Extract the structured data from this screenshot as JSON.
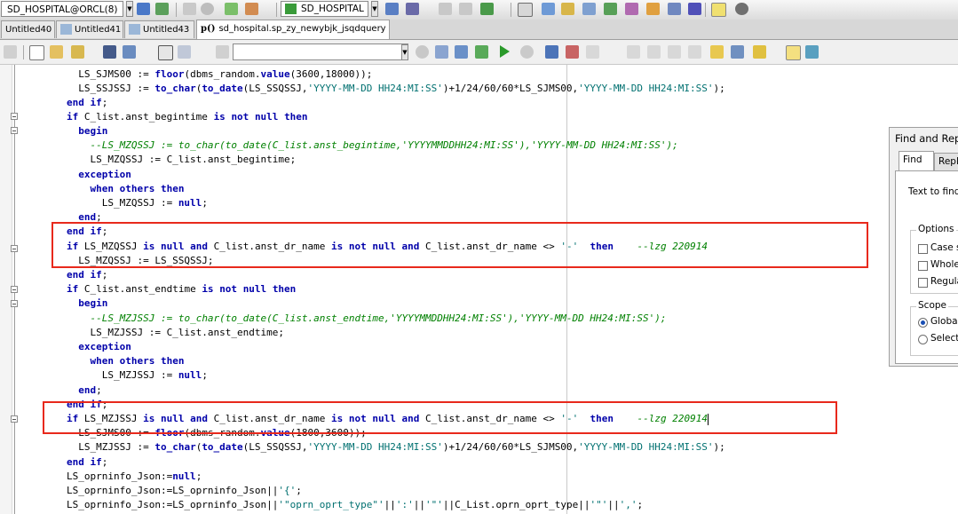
{
  "toolbar": {
    "connection": "SD_HOSPITAL@ORCL(8)",
    "database": "SD_HOSPITAL"
  },
  "tabs": [
    {
      "label": "Untitled40"
    },
    {
      "label": "Untitled41"
    },
    {
      "label": "Untitled43"
    },
    {
      "label": "sd_hospital.sp_zy_newybjk_jsqdquery",
      "prefix": "p()"
    }
  ],
  "find_dialog": {
    "title": "Find and Rep",
    "tab_find": "Find",
    "tab_replace": "Repl",
    "text_to_find_label": "Text to find:",
    "options_label": "Options",
    "options": [
      "Case se",
      "Whole w",
      "Regular"
    ],
    "scope_label": "Scope",
    "scope_options": [
      "Global",
      "Selecte"
    ],
    "scope_selected": "Global"
  },
  "code_lines": [
    "          LS_SJMS00 := floor(dbms_random.value(3600,18000));",
    "          LS_SSJSSJ := to_char(to_date(LS_SSQSSJ,'YYYY-MM-DD HH24:MI:SS')+1/24/60/60*LS_SJMS00,'YYYY-MM-DD HH24:MI:SS');",
    "        end if;",
    "        if C_list.anst_begintime is not null then",
    "          begin",
    "            --LS_MZQSSJ := to_char(to_date(C_list.anst_begintime,'YYYYMMDDHH24:MI:SS'),'YYYY-MM-DD HH24:MI:SS');",
    "            LS_MZQSSJ := C_list.anst_begintime;",
    "          exception",
    "            when others then",
    "              LS_MZQSSJ := null;",
    "          end;",
    "        end if;",
    "        if LS_MZQSSJ is null and C_list.anst_dr_name is not null and C_list.anst_dr_name <> '-'  then    --lzg 220914",
    "          LS_MZQSSJ := LS_SSQSSJ;",
    "        end if;",
    "        if C_list.anst_endtime is not null then",
    "          begin",
    "            --LS_MZJSSJ := to_char(to_date(C_list.anst_endtime,'YYYYMMDDHH24:MI:SS'),'YYYY-MM-DD HH24:MI:SS');",
    "            LS_MZJSSJ := C_list.anst_endtime;",
    "          exception",
    "            when others then",
    "              LS_MZJSSJ := null;",
    "          end;",
    "        end if;",
    "        if LS_MZJSSJ is null and C_list.anst_dr_name is not null and C_list.anst_dr_name <> '-'  then    --lzg 220914",
    "          LS_SJMS00 := floor(dbms_random.value(1800,3600));",
    "          LS_MZJSSJ := to_char(to_date(LS_SSQSSJ,'YYYY-MM-DD HH24:MI:SS')+1/24/60/60*LS_SJMS00,'YYYY-MM-DD HH24:MI:SS');",
    "        end if;",
    "        LS_oprninfo_Json:=null;",
    "        LS_oprninfo_Json:=LS_oprninfo_Json||'{';",
    "        LS_oprninfo_Json:=LS_oprninfo_Json||'\"oprn_oprt_type\"'||':'||'\"'||C_List.oprn_oprt_type||'\"'||',';"
  ],
  "colors": {
    "highlight_border": "#e8291c",
    "keyword": "#0000aa",
    "string": "#007070",
    "comment": "#008000"
  }
}
